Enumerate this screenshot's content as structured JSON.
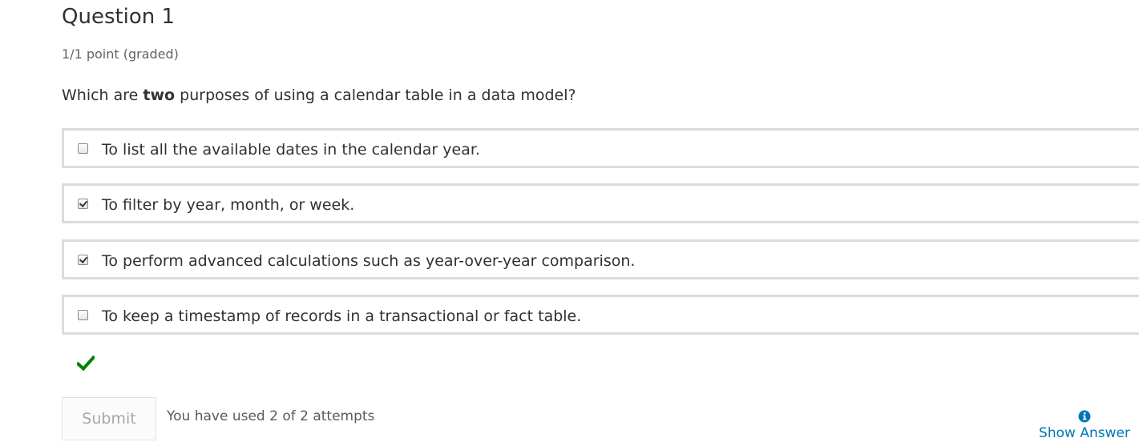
{
  "question": {
    "title": "Question 1",
    "points": "1/1 point (graded)",
    "prompt_before": "Which are ",
    "prompt_bold": "two",
    "prompt_after": " purposes of using a calendar table in a data model?"
  },
  "choices": [
    {
      "label": "To list all the available dates in the calendar year.",
      "checked": false
    },
    {
      "label": "To filter by year, month, or week.",
      "checked": true
    },
    {
      "label": "To perform advanced calculations such as year-over-year comparison.",
      "checked": true
    },
    {
      "label": "To keep a timestamp of records in a transactional or fact table.",
      "checked": false
    }
  ],
  "status": {
    "icon": "checkmark-icon",
    "color": "#008100"
  },
  "actions": {
    "submit_label": "Submit",
    "attempts_text": "You have used 2 of 2 attempts",
    "show_answer_label": "Show Answer",
    "show_answer_icon": "info-icon",
    "link_color": "#0075b4"
  }
}
